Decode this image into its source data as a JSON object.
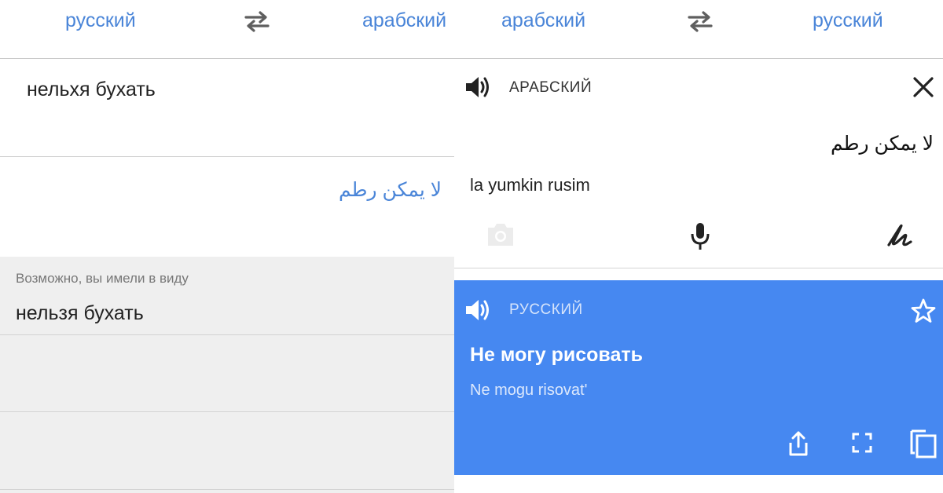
{
  "left_panel": {
    "source_lang": "русский",
    "target_lang": "арабский",
    "input_text": "нельхя бухать",
    "result_text": "لا يمكن رطم",
    "suggestion_label": "Возможно, вы имели в виду",
    "suggestion_text": "нельзя бухать"
  },
  "right_panel": {
    "source_lang": "арабский",
    "target_lang": "русский",
    "source_card": {
      "language": "АРАБСКИЙ",
      "text": "لا يمكن رطم",
      "transliteration": "la yumkin rusim"
    },
    "translation_card": {
      "language": "РУССКИЙ",
      "text": "Не могу рисовать",
      "transliteration": "Ne mogu risovat'"
    }
  },
  "colors": {
    "accent": "#4a85d8",
    "translation_card_bg": "#4688f1",
    "suggestion_bg": "#efefef"
  },
  "icons": [
    "swap-icon",
    "speaker-icon",
    "close-icon",
    "camera-icon",
    "microphone-icon",
    "handwriting-icon",
    "star-icon",
    "share-icon",
    "fullscreen-icon",
    "copy-icon"
  ]
}
